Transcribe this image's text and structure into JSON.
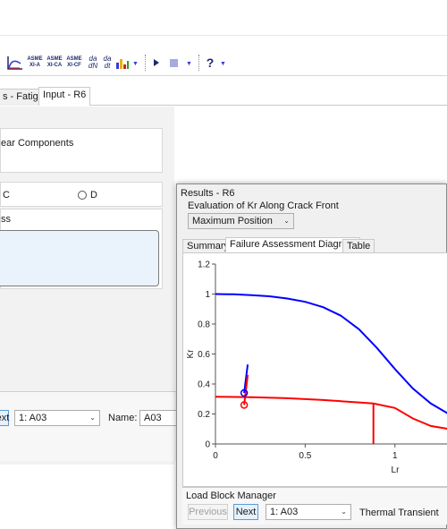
{
  "toolbar": {
    "asme1": {
      "l1": "ASME",
      "l2": "XI-A"
    },
    "asme2": {
      "l1": "ASME",
      "l2": "XI-CA"
    },
    "asme3": {
      "l1": "ASME",
      "l2": "XI-CF"
    },
    "dadn": {
      "num": "da",
      "den": "dN"
    },
    "dadt": {
      "num": "da",
      "den": "dt"
    },
    "help": "?"
  },
  "tabs": [
    {
      "label": "s - Fatigue"
    },
    {
      "label": "Input - R6"
    }
  ],
  "left_panel": {
    "group_label": "ear Components",
    "radio_c": "C",
    "radio_d": "D",
    "section_label": "ss"
  },
  "bottom_bar": {
    "next_label": "ext",
    "combo_value": "1: A03",
    "name_label": "Name:",
    "name_value": "A03"
  },
  "results": {
    "title": "Results - R6",
    "subtitle": "Evaluation of Kr Along Crack Front",
    "position_combo": "Maximum Position",
    "tabs": [
      {
        "label": "Summary"
      },
      {
        "label": "Failure Assessment Diagram"
      },
      {
        "label": "Table"
      }
    ],
    "load_block": {
      "header": "Load Block Manager",
      "previous_label": "Previous",
      "next_label": "Next",
      "combo_value": "1: A03",
      "case_name": "Thermal Transient"
    }
  },
  "chart_data": {
    "type": "line",
    "xlabel": "Lr",
    "ylabel": "Kr",
    "xlim": [
      0,
      1.3
    ],
    "ylim": [
      0,
      1.2
    ],
    "xticks": [
      "0",
      "0.5",
      "1"
    ],
    "yticks": [
      "0",
      "0.2",
      "0.4",
      "0.6",
      "0.8",
      "1",
      "1.2"
    ],
    "series": [
      {
        "color": "#0000ff",
        "x": [
          0,
          0.1,
          0.2,
          0.3,
          0.4,
          0.5,
          0.6,
          0.7,
          0.8,
          0.9,
          1.0,
          1.1,
          1.2,
          1.3
        ],
        "y": [
          1.0,
          0.998,
          0.993,
          0.985,
          0.97,
          0.948,
          0.912,
          0.855,
          0.765,
          0.64,
          0.5,
          0.37,
          0.27,
          0.2
        ]
      },
      {
        "color": "#0000ff",
        "x": [
          0.16,
          0.18
        ],
        "y": [
          0.34,
          0.53
        ]
      },
      {
        "color": "#ff0000",
        "x": [
          0,
          0.2,
          0.4,
          0.6,
          0.8,
          0.88,
          1.0,
          1.1,
          1.2,
          1.3
        ],
        "y": [
          0.315,
          0.312,
          0.305,
          0.293,
          0.277,
          0.27,
          0.24,
          0.17,
          0.12,
          0.1
        ]
      },
      {
        "color": "#ff0000",
        "x": [
          0.16,
          0.18
        ],
        "y": [
          0.26,
          0.46
        ]
      },
      {
        "color": "#ff0000",
        "x": [
          0.88,
          0.88
        ],
        "y": [
          0,
          0.27
        ]
      }
    ],
    "markers": [
      {
        "color": "#0000ff",
        "x": 0.16,
        "y": 0.34
      },
      {
        "color": "#ff0000",
        "x": 0.16,
        "y": 0.26
      }
    ]
  }
}
